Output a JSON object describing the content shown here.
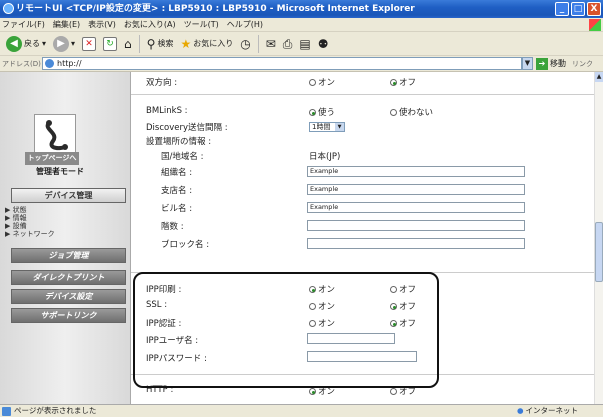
{
  "window": {
    "title": "リモートUI <TCP/IP設定の変更> : LBP5910 : LBP5910 - Microsoft Internet Explorer",
    "buttons": {
      "minimize": "_",
      "maximize": "□",
      "close": "X"
    }
  },
  "menubar": {
    "items": [
      "ファイル(F)",
      "編集(E)",
      "表示(V)",
      "お気に入り(A)",
      "ツール(T)",
      "ヘルプ(H)"
    ]
  },
  "toolbar": {
    "back_label": "戻る",
    "search_label": "検索",
    "favorites_label": "お気に入り",
    "icons": [
      "back-icon",
      "forward-icon",
      "stop-icon",
      "refresh-icon",
      "home-icon",
      "search-icon",
      "favorites-icon",
      "history-icon",
      "mail-icon",
      "print-icon",
      "edit-icon",
      "messenger-icon"
    ]
  },
  "address": {
    "label": "アドレス(D)",
    "url": "http://",
    "go_label": "移動",
    "links_label": "リンク"
  },
  "leftnav": {
    "top_link": "トップページへ",
    "admin_mode": "管理者モード",
    "device_manage": "デバイス管理",
    "subitems": [
      "▶ 状態",
      "▶ 情報",
      "▶ 設備",
      "▶ ネットワーク"
    ],
    "job_manage": "ジョブ管理",
    "direct_print": "ダイレクトプリント",
    "device_settings": "デバイス設定",
    "support_link": "サポートリンク"
  },
  "form": {
    "bidirectional": {
      "label": "双方向 :",
      "on": "オン",
      "off": "オフ",
      "selected": "off"
    },
    "bmlinks": {
      "label": "BMLinkS :",
      "use": "使う",
      "nouse": "使わない",
      "selected": "use"
    },
    "discovery": {
      "label": "Discovery送信間隔 :",
      "value": "1時間"
    },
    "location_info": {
      "label": "設置場所の情報 :"
    },
    "country": {
      "label": "国/地域名 :",
      "value": "日本(JP)"
    },
    "organization": {
      "label": "組織名 :",
      "value": "Example"
    },
    "branch": {
      "label": "支店名 :",
      "value": "Example"
    },
    "building": {
      "label": "ビル名 :",
      "value": "Example"
    },
    "floor": {
      "label": "階数 :",
      "value": ""
    },
    "block": {
      "label": "ブロック名 :",
      "value": ""
    },
    "ipp_print": {
      "label": "IPP印刷 :",
      "on": "オン",
      "off": "オフ",
      "selected": "on"
    },
    "ssl": {
      "label": "SSL :",
      "on": "オン",
      "off": "オフ",
      "selected": "off"
    },
    "ipp_auth": {
      "label": "IPP認証 :",
      "on": "オン",
      "off": "オフ",
      "selected": "off"
    },
    "ipp_user": {
      "label": "IPPユーザ名 :",
      "value": ""
    },
    "ipp_password": {
      "label": "IPPパスワード :",
      "value": ""
    },
    "http": {
      "label": "HTTP :",
      "on": "オン",
      "off": "オフ",
      "selected": "on"
    }
  },
  "statusbar": {
    "text": "ページが表示されました",
    "zone": "インターネット"
  }
}
